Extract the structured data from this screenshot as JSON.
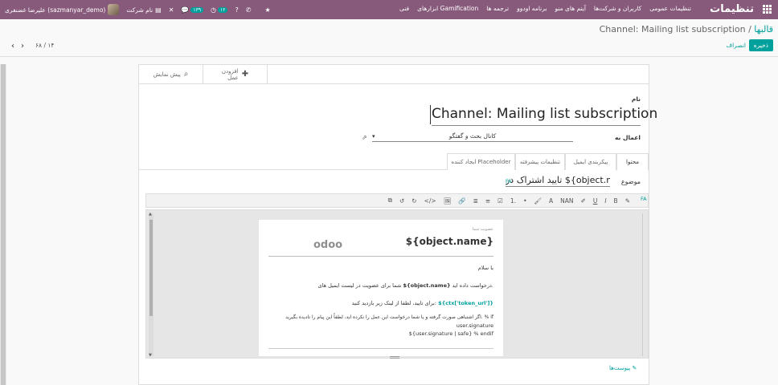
{
  "navbar": {
    "brand": "تنظیمات",
    "menus": [
      "تنظیمات عمومی",
      "کاربران و شرکت‌ها",
      "آیتم های منو",
      "برنامه اودوو",
      "ترجمه ها",
      "ابزارهای Gamification",
      "فنی"
    ],
    "user_name": "علیرضا غضنفری (sazmanyar_demo)",
    "company_label": "نام شرکت",
    "activity_count": "۱۲",
    "messages_count": "۱۳۹"
  },
  "breadcrumb": {
    "parent": "قالبها",
    "separator": "/",
    "current": "Channel: Mailing list subscription"
  },
  "actions": {
    "save": "ذخیره",
    "discard": "انصراف"
  },
  "pager": {
    "text": "۶۸ / ۱۴"
  },
  "smart_buttons": {
    "preview": "پیش نمایش",
    "add_action_line1": "افزودن",
    "add_action_line2": "عمل"
  },
  "form": {
    "name_label": "نام",
    "name_value": "Channel: Mailing list subscription",
    "apply_to_label": "اعمال به",
    "apply_to_value": "کانال بحث و گفتگو"
  },
  "tabs": [
    "محتوا",
    "پیکربندی ایمیل",
    "تنظیمات پیشرفته",
    "ایجاد کننده Placeholder"
  ],
  "subject": {
    "label": "موضوع",
    "value": "تایید اشتراک در ${object.name}",
    "lang": "FA"
  },
  "toolbar": {
    "items": [
      "✎",
      "B",
      "I",
      "U",
      "✐",
      "NAN",
      "A",
      "🖌",
      "•",
      "1.",
      "☑",
      "≡",
      "≣",
      "🔗",
      "🖼",
      "</>",
      "↻",
      "↺",
      "⧉"
    ],
    "lang": "FA"
  },
  "email_body": {
    "small_header": "عضویت شما",
    "title": "${object.name}",
    "logo": "odoo",
    "greeting": "با سلام",
    "line1_prefix": "شما برای عضویت در لیست ایمیل های",
    "line1_bold": "${object.name}",
    "line1_suffix": "درخواست داده اید.",
    "line2_prefix": "برای تایید، لطفا از لینک زیر بازدید کنید:",
    "line2_link": "${ctx['token_url']}",
    "line3": "اگر اشتباهی صورت گرفته و یا شما درخواست این عمل را نکرده اید، لطفاً این پیام را نادیده بگیرید. % if",
    "line4": "user.signature",
    "line5": "${user.signature | safe} % endif"
  },
  "attachments_label": "پیوست‌ها"
}
